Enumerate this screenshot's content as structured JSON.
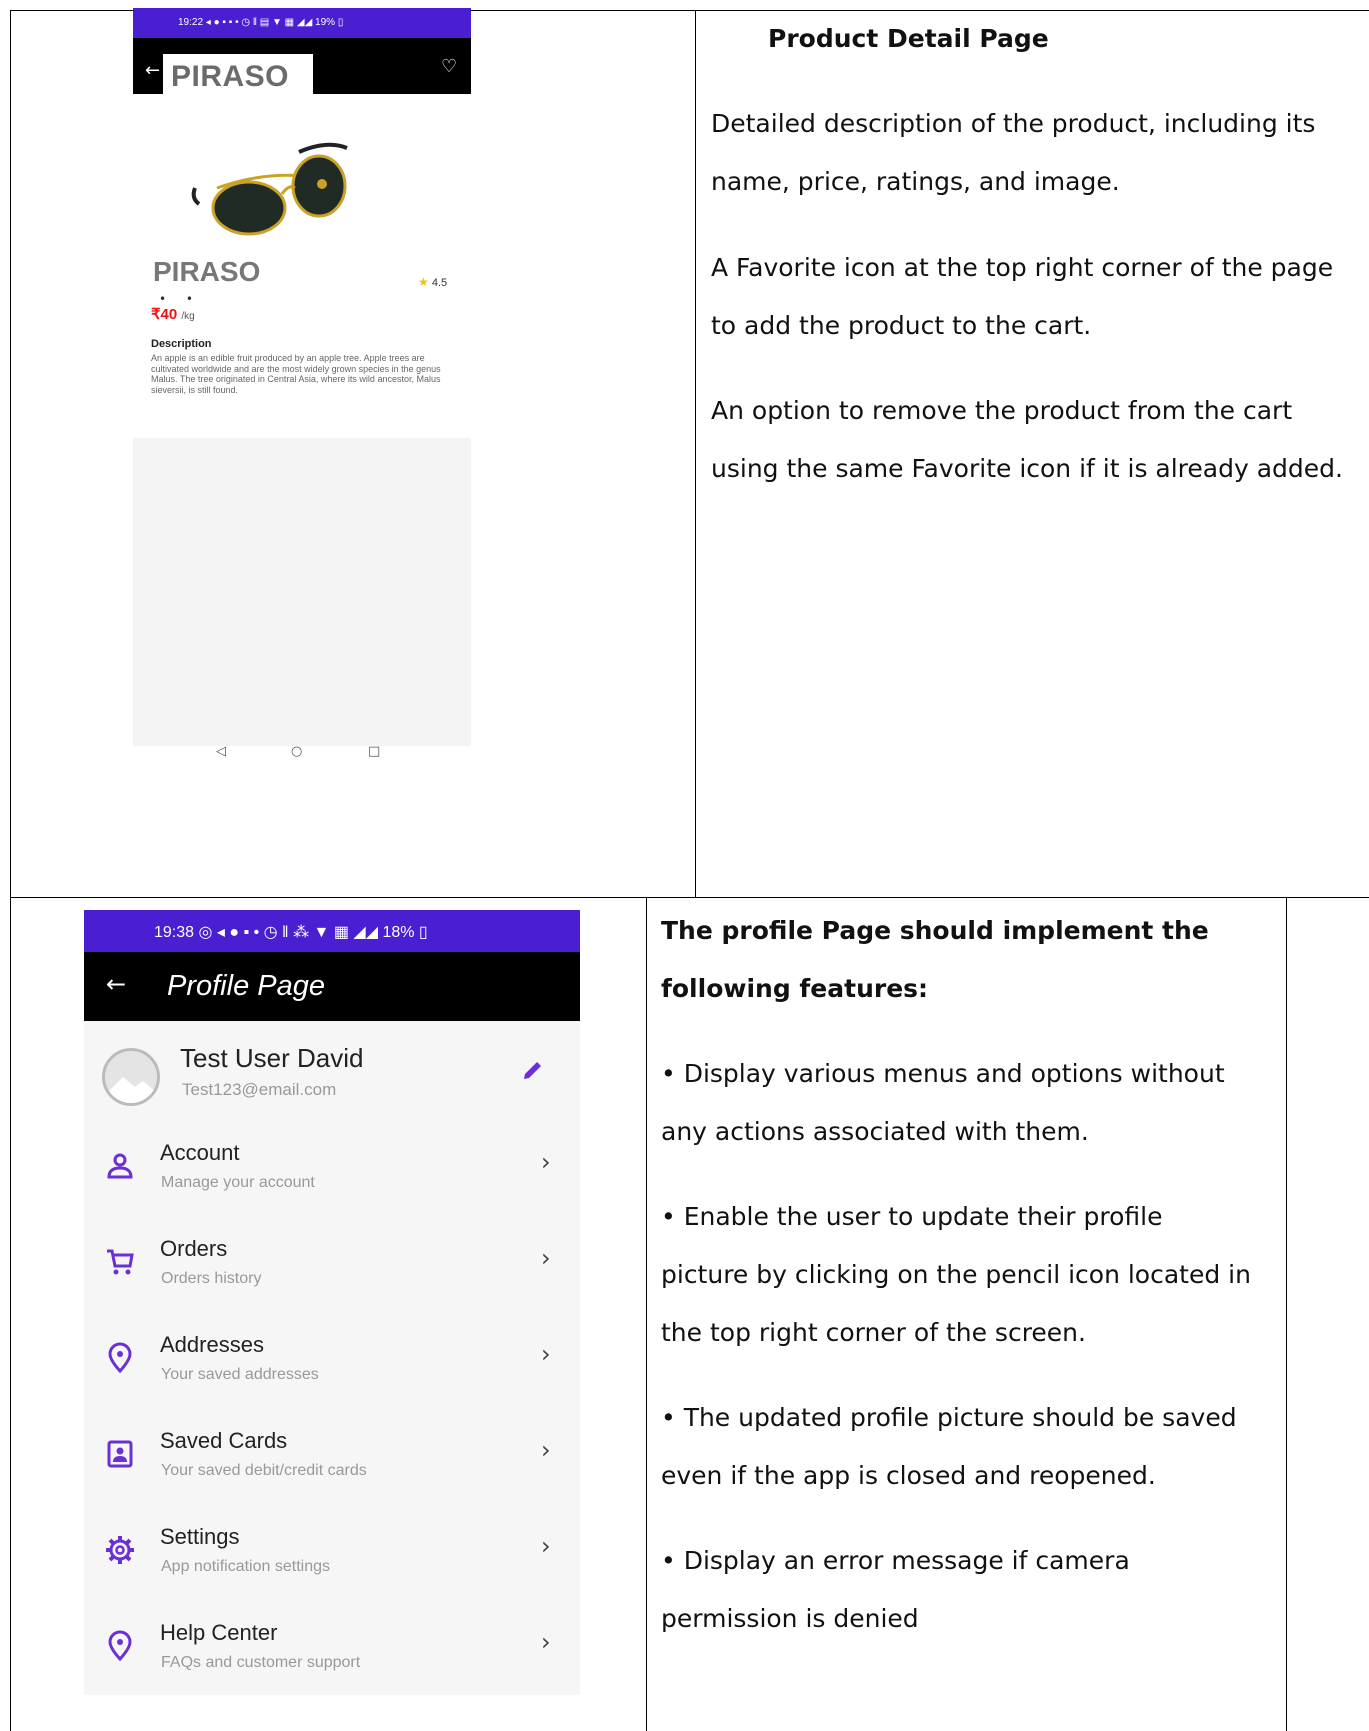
{
  "top_phone": {
    "status_bar": "19:22 ◂ ● ▪ ▪ • ◷ ‖ ▤ ▼ ▦ ◢◢ 19% ▯",
    "back_glyph": "←",
    "app_title": "PIRASO",
    "favorite_glyph": "♡",
    "product_name": "PIRASO",
    "rating": "4.5",
    "rating_star": "★",
    "dots": "• •",
    "price": "₹40",
    "unit": "/kg",
    "description_heading": "Description",
    "description": "An apple is an edible fruit produced by an apple tree. Apple trees are cultivated worldwide and are the most widely grown species in the genus Malus. The tree originated in Central Asia, where its wild ancestor, Malus sieversii, is still found.",
    "nav": {
      "back": "◁",
      "home": "○",
      "recent": "□"
    }
  },
  "top_text": {
    "heading": "Product Detail Page",
    "lines": [
      "Detailed description of the product, including its",
      "name, price, ratings, and image.",
      "A Favorite icon at the top right corner of the page",
      "to add the product to the cart.",
      "An option to remove the product from the cart",
      "using the same Favorite icon if it is already added."
    ]
  },
  "bottom_phone": {
    "status_bar": "19:38 ◎ ◂ ● ▪ • ◷ ‖ ⁂ ▼ ▦ ◢◢ 18% ▯",
    "back_glyph": "←",
    "title": "Profile Page",
    "user_name": "Test User David",
    "user_email": "Test123@email.com",
    "chevron": "›",
    "menu": [
      {
        "label": "Account",
        "sub": "Manage your account",
        "icon": "person-icon"
      },
      {
        "label": "Orders",
        "sub": "Orders history",
        "icon": "cart-icon"
      },
      {
        "label": "Addresses",
        "sub": "Your saved addresses",
        "icon": "location-pin-icon"
      },
      {
        "label": "Saved Cards",
        "sub": "Your saved debit/credit cards",
        "icon": "card-icon"
      },
      {
        "label": "Settings",
        "sub": "App notification settings",
        "icon": "gear-icon"
      },
      {
        "label": "Help Center",
        "sub": "FAQs and customer support",
        "icon": "location-pin-icon"
      }
    ]
  },
  "bottom_text": {
    "lines": [
      "The profile Page should implement the",
      "following features:",
      "• Display various menus and options without",
      "any actions associated with them.",
      "• Enable the user to update their profile",
      "picture by clicking on the pencil icon located in",
      "the top right corner of the screen.",
      "• The updated profile picture should be saved",
      "even if the app is closed and reopened.",
      "• Display an error message if camera",
      "permission is denied"
    ]
  },
  "colors": {
    "accent": "#4a1fd1",
    "icon": "#6a2fd6",
    "price": "#e11111",
    "star": "#f2c200"
  }
}
